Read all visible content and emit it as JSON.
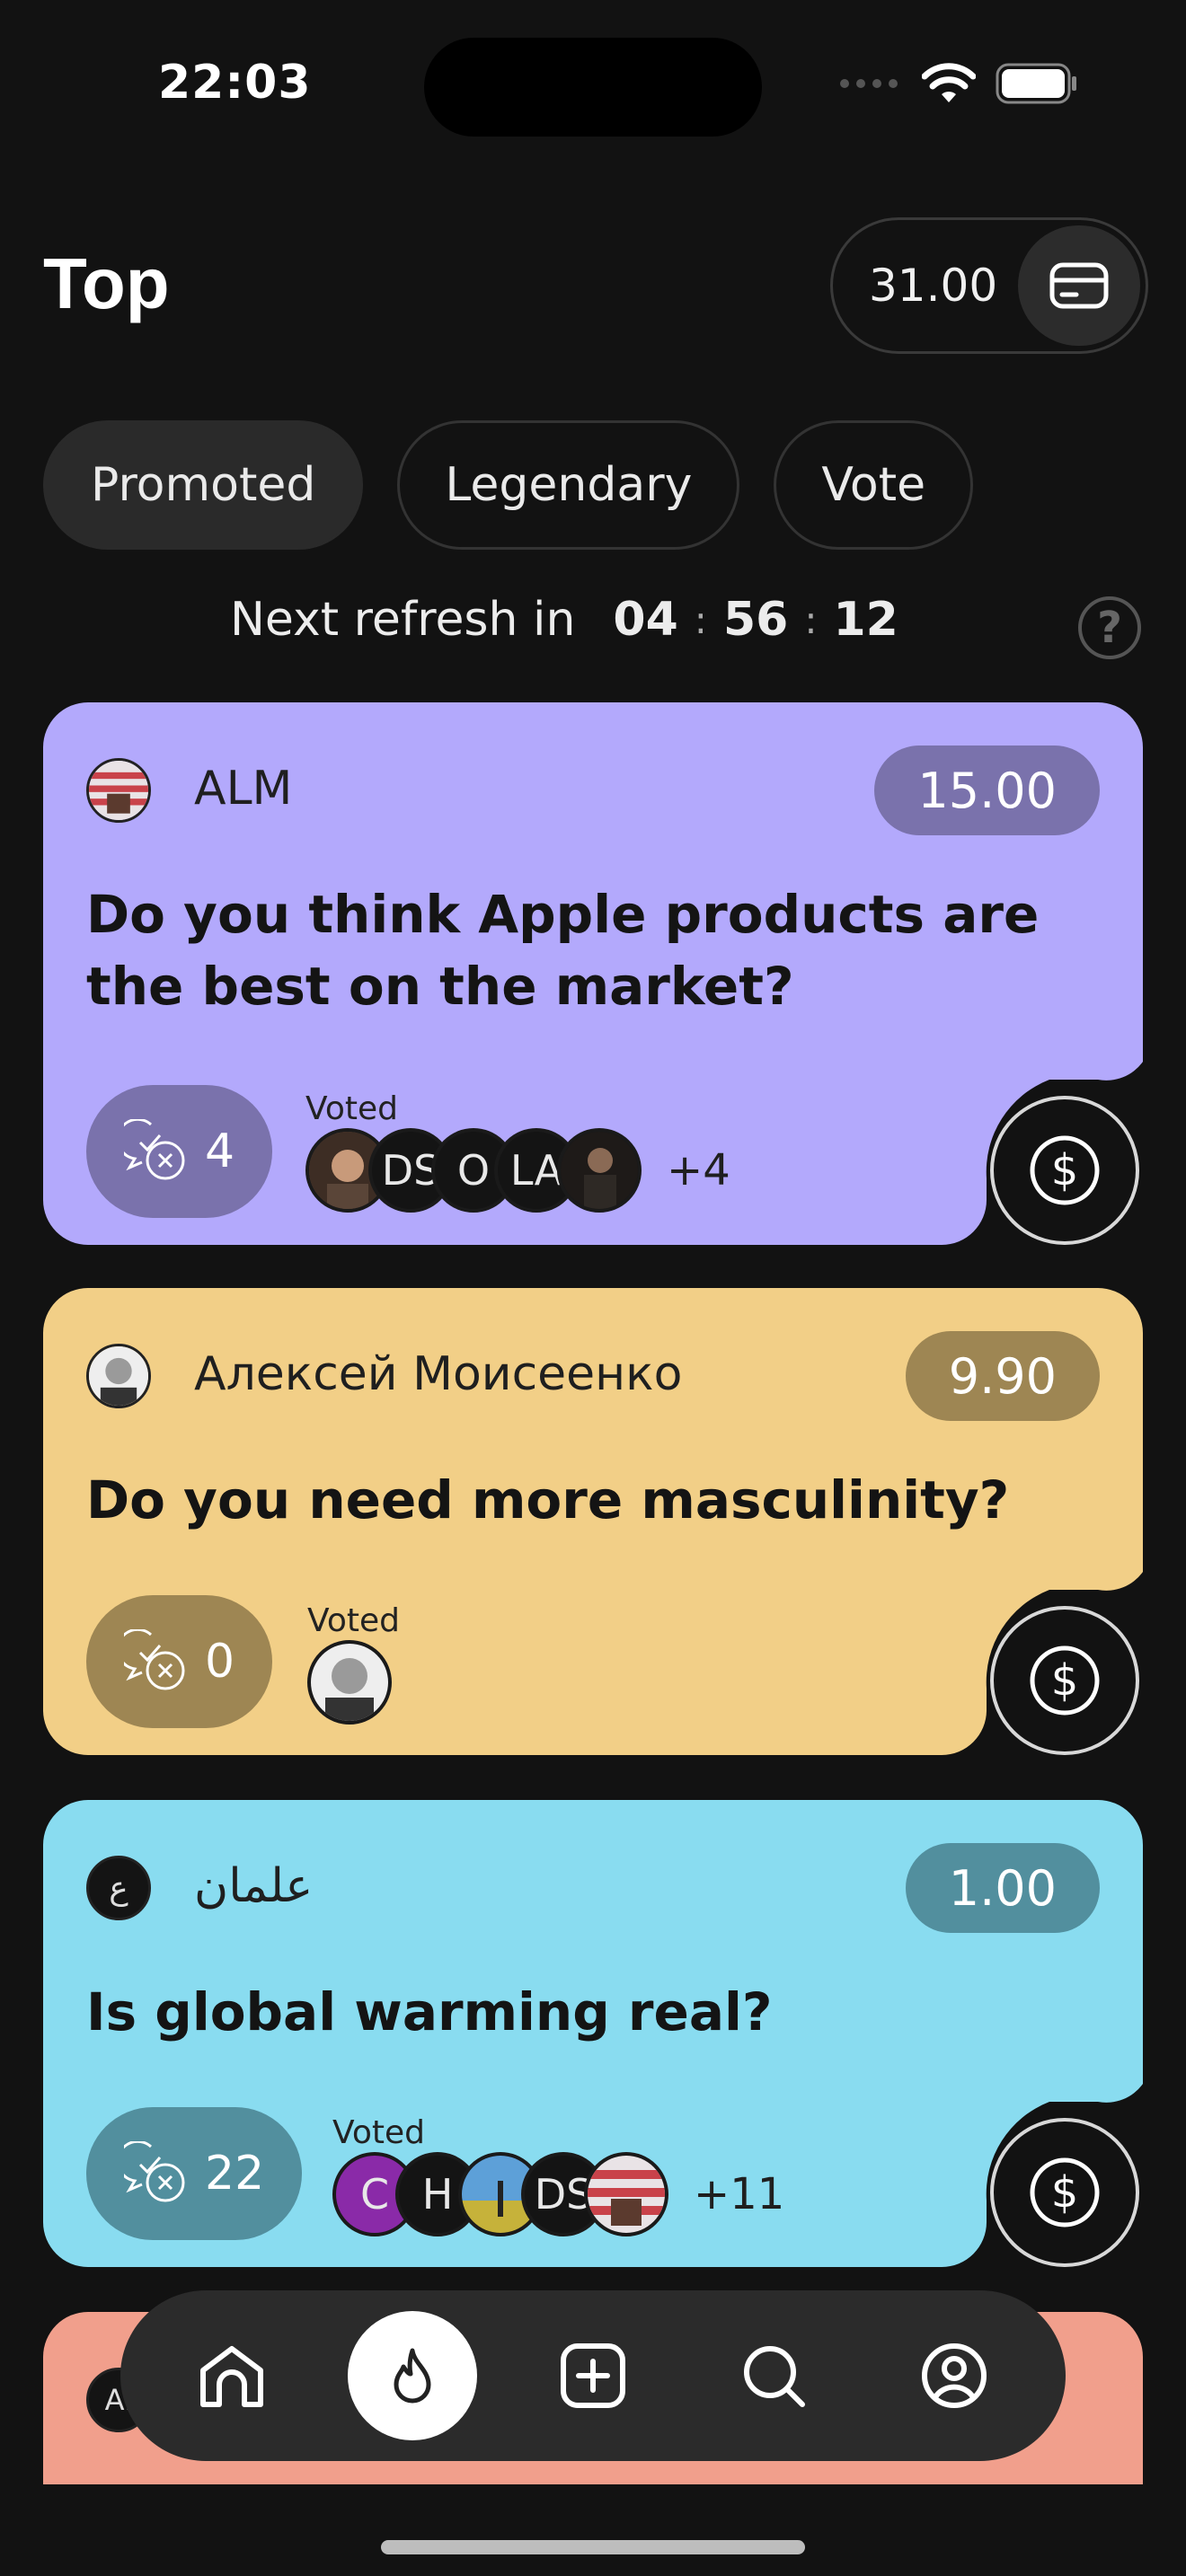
{
  "status_bar": {
    "time": "22:03"
  },
  "header": {
    "title": "Top",
    "balance": "31.00"
  },
  "tabs": [
    {
      "label": "Promoted",
      "active": true
    },
    {
      "label": "Legendary",
      "active": false
    },
    {
      "label": "Vote",
      "active": false
    }
  ],
  "refresh": {
    "label": "Next refresh in",
    "hours": "04",
    "minutes": "56",
    "seconds": "12",
    "help_icon": "?"
  },
  "cards": [
    {
      "author": "ALM",
      "price": "15.00",
      "question": "Do you think Apple products are the best on the market?",
      "comments": "4",
      "voted_label": "Voted",
      "voters": [
        "DS",
        "O",
        "LA"
      ],
      "more": "+4",
      "color": "#b3a9fc",
      "accent": "#7a72ac"
    },
    {
      "author": "Алексей Моисеенко",
      "price": "9.90",
      "question": "Do you need more masculinity?",
      "comments": "0",
      "voted_label": "Voted",
      "voters": [],
      "more": "",
      "color": "#f2cf87",
      "accent": "#9e8653"
    },
    {
      "author": "علمان",
      "author_initial": "ع",
      "price": "1.00",
      "question": "Is global warming real?",
      "comments": "22",
      "voted_label": "Voted",
      "voters": [
        "C",
        "H",
        "DS"
      ],
      "more": "+11",
      "color": "#89dcf0",
      "accent": "#528f9e"
    },
    {
      "author_initial": "Al",
      "color": "#f19f8c"
    }
  ],
  "nav": [
    "home-icon",
    "fire-icon",
    "add-icon",
    "search-icon",
    "profile-icon"
  ]
}
